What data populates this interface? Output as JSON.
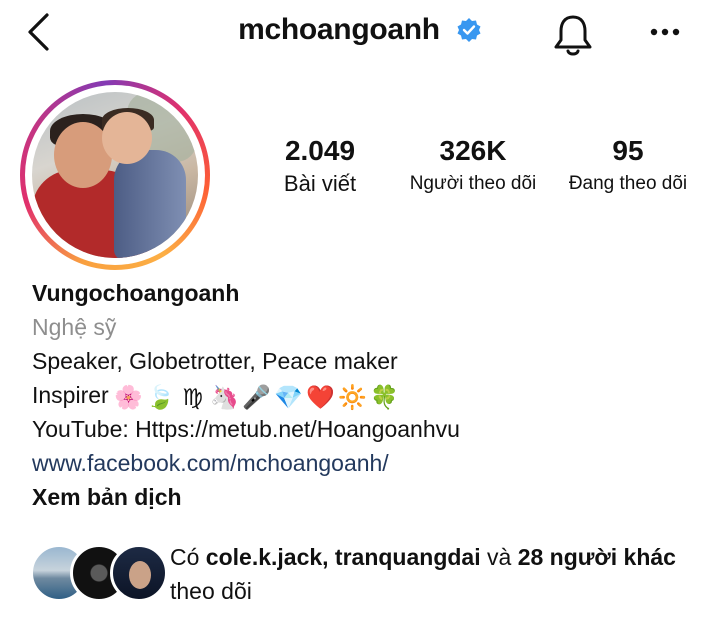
{
  "header": {
    "username": "mchoangoanh",
    "back_icon": "chevron-left-icon",
    "verified_icon": "verified-badge-icon",
    "bell_icon": "bell-icon",
    "more_icon": "more-horizontal-icon",
    "verified_color": "#3897f0"
  },
  "stats": {
    "posts": {
      "value": "2.049",
      "label": "Bài viết"
    },
    "followers": {
      "value": "326K",
      "label": "Người theo dõi"
    },
    "following": {
      "value": "95",
      "label": "Đang theo dõi"
    }
  },
  "bio": {
    "name": "Vungochoangoanh",
    "category": "Nghệ sỹ",
    "line1": "Speaker, Globetrotter, Peace maker",
    "line2_text": "Inspirer",
    "emojis": [
      "🌸",
      "🍃",
      "♍",
      "🦄",
      "🎤",
      "💎",
      "❤️",
      "🔆",
      "🍀"
    ],
    "line3": "YouTube: Https://metub.net/Hoangoanhvu",
    "link": "www.facebook.com/mchoangoanh/",
    "translate": "Xem bản dịch"
  },
  "followed_by": {
    "prefix": "Có",
    "names": "cole.k.jack, tranquangdai",
    "and": "và",
    "others": "28 người khác",
    "suffix": "theo dõi"
  },
  "colors": {
    "link": "#23395d",
    "muted": "#8e8e8e",
    "story_ring": [
      "#fcaf45",
      "#e1306c",
      "#833ab4"
    ]
  }
}
